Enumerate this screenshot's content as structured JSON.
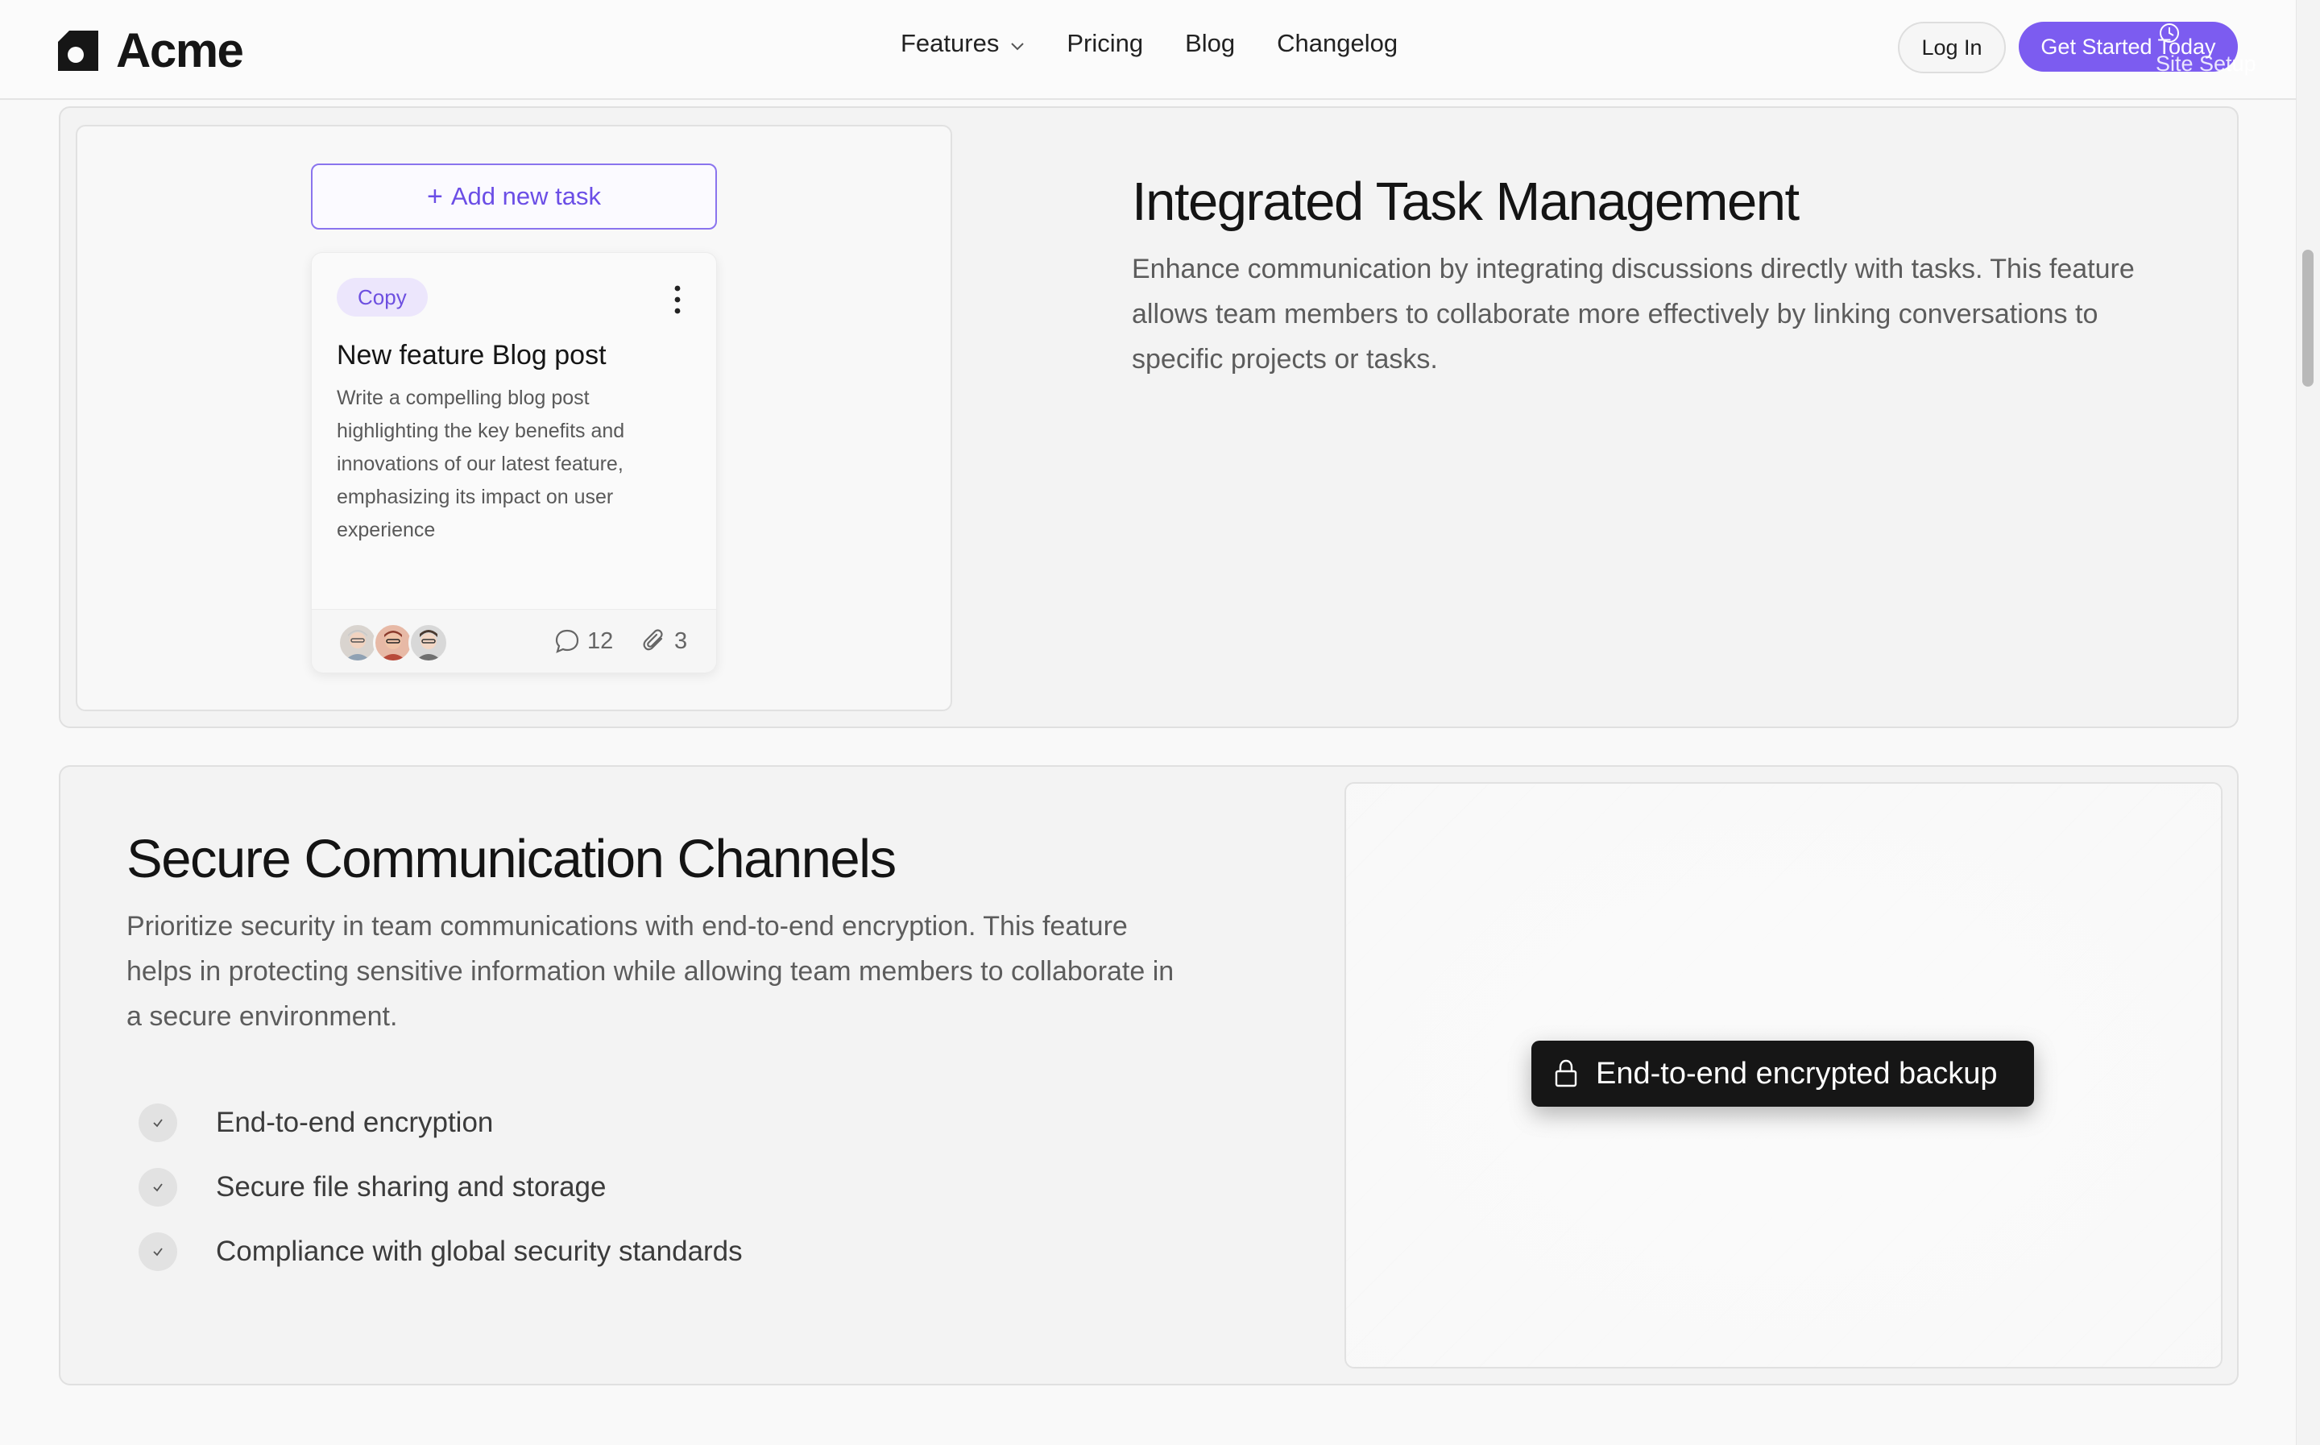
{
  "header": {
    "brand": "Acme",
    "nav": [
      {
        "label": "Features",
        "has_dropdown": true
      },
      {
        "label": "Pricing"
      },
      {
        "label": "Blog"
      },
      {
        "label": "Changelog"
      }
    ],
    "login_label": "Log In",
    "cta_label": "Get Started Today",
    "overlay_label": "Site Setup",
    "accent_color": "#7c5cf0"
  },
  "task_section": {
    "add_task_label": "Add new task",
    "card": {
      "tag": "Copy",
      "title": "New feature Blog post",
      "description": "Write a compelling blog post highlighting the key benefits and innovations of our latest feature, emphasizing its impact on user experience",
      "comments": "12",
      "attachments": "3"
    },
    "title": "Integrated Task Management",
    "description": "Enhance communication by integrating discussions directly with tasks. This feature allows team members to collaborate more effectively by linking conversations to specific projects or tasks."
  },
  "security_section": {
    "title": "Secure Communication Channels",
    "description": "Prioritize security in team communications with end-to-end encryption. This feature helps in protecting sensitive information while allowing team members to collaborate in a secure environment.",
    "features": [
      "End-to-end encryption",
      "Secure file sharing and storage",
      "Compliance with global security standards"
    ],
    "badge_label": "End-to-end encrypted backup",
    "badge_icon": "lock-icon"
  }
}
